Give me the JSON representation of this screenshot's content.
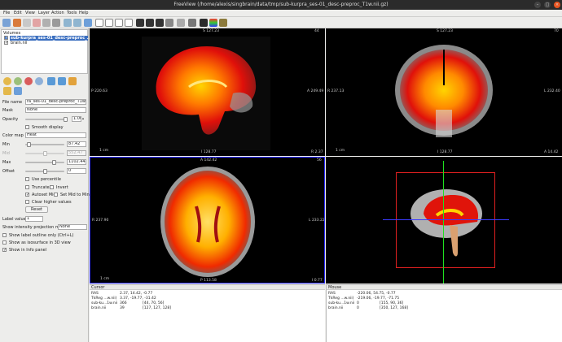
{
  "window": {
    "title": "FreeView (/home/alexis/singbrain/data/tmp/sub-kurpra_ses-01_desc-preproc_T1w.nii.gz)"
  },
  "menu": [
    "File",
    "Edit",
    "View",
    "Layer",
    "Action",
    "Tools",
    "Help"
  ],
  "volumes": {
    "header": "Volumes",
    "items": [
      "sub-kurpra_ses-01_desc-preproc_...",
      "brain.nii"
    ]
  },
  "props": {
    "file_name_label": "File name",
    "file_name_value": "ra_ses-01_desc-preproc_T1w.nii.gz",
    "mask_label": "Mask",
    "mask_value": "None",
    "opacity_label": "Opacity",
    "opacity_value": "1.00",
    "smooth_label": "Smooth display",
    "colormap_label": "Color map",
    "colormap_value": "Heat",
    "min_label": "Min",
    "min_value": "87.42",
    "mid_label": "Mid",
    "mid_value": "552.47",
    "max_label": "Max",
    "max_value": "1102.44",
    "offset_label": "Offset",
    "offset_value": "0",
    "use_percentile": "Use percentile",
    "truncate": "Truncate",
    "invert": "Invert",
    "automid": "Autoset Mid",
    "setmid": "Set Mid to Min",
    "clear_higher": "Clear higher values",
    "reset": "Reset",
    "label_value_label": "Label value",
    "label_value": "1",
    "show_ipm_label": "Show intensity projection map",
    "show_ipm_value": "None",
    "label_outline": "Show label outline only (Ctrl+L)",
    "isosurface": "Show as isosurface in 3D view",
    "info_panel": "Show in Info panel"
  },
  "views": {
    "sagittal": {
      "top": "S 127.23",
      "right": "A 249.49",
      "left": "P 220.63",
      "bottom": "I 128.77",
      "br": "R 2.37",
      "tr": "44",
      "sb": "1 cm"
    },
    "coronal": {
      "top": "S 127.23",
      "right": "L 232.40",
      "left": "R 237.13",
      "bottom": "I 128.77",
      "br": "A 14.42",
      "tr": "70",
      "sb": "1 cm"
    },
    "axial": {
      "top": "A 142.42",
      "right": "L 233.22",
      "left": "R 237.90",
      "bottom": "P 113.58",
      "br": "I 0.77",
      "tr": "56",
      "sb": "1 cm"
    }
  },
  "cursor": {
    "header": "Cursor",
    "rows": [
      [
        "RAS",
        "2.37, 14.42, -0.77",
        ""
      ],
      [
        "TkReg ...w.nii)",
        "3.37, -19.77, -31.42",
        ""
      ],
      [
        "sub-ku...1w.nii",
        "366",
        "[44, 70, 56]"
      ],
      [
        "brain.nii",
        "39",
        "[127, 127, 128]"
      ]
    ]
  },
  "mouse": {
    "header": "Mouse",
    "rows": [
      [
        "RAS",
        "-220.06, 54.75, -0.77",
        ""
      ],
      [
        "TkReg ...w.nii)",
        "-219.06, -19.77, -71.75",
        ""
      ],
      [
        "sub-ku...1w.nii",
        "0",
        "[155, 90, 36]"
      ],
      [
        "brain.nii",
        "0",
        "[350, 127, 168]"
      ]
    ]
  },
  "colors": {
    "selected_view": "#2b2bff",
    "heat_core": "#ffd400",
    "heat_mid": "#ff3b00"
  }
}
